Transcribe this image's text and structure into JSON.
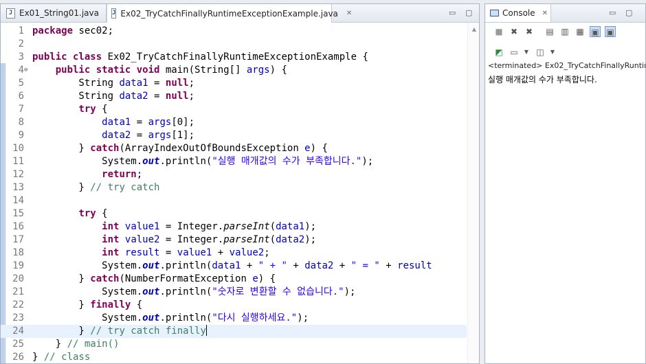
{
  "editor": {
    "tabs": [
      {
        "label": "Ex01_String01.java",
        "active": false
      },
      {
        "label": "Ex02_TryCatchFinallyRuntimeExceptionExample.java",
        "active": true
      }
    ],
    "close_glyph": "✕",
    "minimize_glyph": "▭",
    "maximize_glyph": "▢",
    "current_line": 24,
    "lines": [
      {
        "n": "1",
        "t": [
          [
            "k",
            "package"
          ],
          [
            "p",
            " sec02;"
          ]
        ]
      },
      {
        "n": "2",
        "t": []
      },
      {
        "n": "3",
        "t": [
          [
            "k",
            "public class"
          ],
          [
            "p",
            " Ex02_TryCatchFinallyRuntimeExceptionExample {"
          ]
        ]
      },
      {
        "n": "4",
        "fold": "⊖",
        "t": [
          [
            "p",
            "    "
          ],
          [
            "k",
            "public static void"
          ],
          [
            "p",
            " main(String[] "
          ],
          [
            "f",
            "args"
          ],
          [
            "p",
            ") {"
          ]
        ]
      },
      {
        "n": "5",
        "t": [
          [
            "p",
            "        String "
          ],
          [
            "f",
            "data1"
          ],
          [
            "p",
            " = "
          ],
          [
            "k",
            "null"
          ],
          [
            "p",
            ";"
          ]
        ]
      },
      {
        "n": "6",
        "t": [
          [
            "p",
            "        String "
          ],
          [
            "f",
            "data2"
          ],
          [
            "p",
            " = "
          ],
          [
            "k",
            "null"
          ],
          [
            "p",
            ";"
          ]
        ]
      },
      {
        "n": "7",
        "t": [
          [
            "p",
            "        "
          ],
          [
            "k",
            "try"
          ],
          [
            "p",
            " {"
          ]
        ]
      },
      {
        "n": "8",
        "t": [
          [
            "p",
            "            "
          ],
          [
            "f",
            "data1"
          ],
          [
            "p",
            " = "
          ],
          [
            "f",
            "args"
          ],
          [
            "p",
            "[0];"
          ]
        ]
      },
      {
        "n": "9",
        "t": [
          [
            "p",
            "            "
          ],
          [
            "f",
            "data2"
          ],
          [
            "p",
            " = "
          ],
          [
            "f",
            "args"
          ],
          [
            "p",
            "[1];"
          ]
        ]
      },
      {
        "n": "10",
        "t": [
          [
            "p",
            "        } "
          ],
          [
            "k",
            "catch"
          ],
          [
            "p",
            "(ArrayIndexOutOfBoundsException "
          ],
          [
            "f",
            "e"
          ],
          [
            "p",
            ") {"
          ]
        ]
      },
      {
        "n": "11",
        "t": [
          [
            "p",
            "            System."
          ],
          [
            "sf",
            "out"
          ],
          [
            "p",
            ".println("
          ],
          [
            "s",
            "\"실행 매개값의 수가 부족합니다.\""
          ],
          [
            "p",
            ");"
          ]
        ]
      },
      {
        "n": "12",
        "t": [
          [
            "p",
            "            "
          ],
          [
            "k",
            "return"
          ],
          [
            "p",
            ";"
          ]
        ]
      },
      {
        "n": "13",
        "t": [
          [
            "p",
            "        } "
          ],
          [
            "c",
            "// try catch"
          ]
        ]
      },
      {
        "n": "14",
        "t": []
      },
      {
        "n": "15",
        "t": [
          [
            "p",
            "        "
          ],
          [
            "k",
            "try"
          ],
          [
            "p",
            " {"
          ]
        ]
      },
      {
        "n": "16",
        "t": [
          [
            "p",
            "            "
          ],
          [
            "k",
            "int"
          ],
          [
            "p",
            " "
          ],
          [
            "f",
            "value1"
          ],
          [
            "p",
            " = Integer."
          ],
          [
            "i",
            "parseInt"
          ],
          [
            "p",
            "("
          ],
          [
            "f",
            "data1"
          ],
          [
            "p",
            ");"
          ]
        ]
      },
      {
        "n": "17",
        "t": [
          [
            "p",
            "            "
          ],
          [
            "k",
            "int"
          ],
          [
            "p",
            " "
          ],
          [
            "f",
            "value2"
          ],
          [
            "p",
            " = Integer."
          ],
          [
            "i",
            "parseInt"
          ],
          [
            "p",
            "("
          ],
          [
            "f",
            "data2"
          ],
          [
            "p",
            ");"
          ]
        ]
      },
      {
        "n": "18",
        "t": [
          [
            "p",
            "            "
          ],
          [
            "k",
            "int"
          ],
          [
            "p",
            " "
          ],
          [
            "f",
            "result"
          ],
          [
            "p",
            " = "
          ],
          [
            "f",
            "value1"
          ],
          [
            "p",
            " + "
          ],
          [
            "f",
            "value2"
          ],
          [
            "p",
            ";"
          ]
        ]
      },
      {
        "n": "19",
        "t": [
          [
            "p",
            "            System."
          ],
          [
            "sf",
            "out"
          ],
          [
            "p",
            ".println("
          ],
          [
            "f",
            "data1"
          ],
          [
            "p",
            " + "
          ],
          [
            "s",
            "\" + \""
          ],
          [
            "p",
            " + "
          ],
          [
            "f",
            "data2"
          ],
          [
            "p",
            " + "
          ],
          [
            "s",
            "\" = \""
          ],
          [
            "p",
            " + "
          ],
          [
            "f",
            "result"
          ]
        ]
      },
      {
        "n": "20",
        "t": [
          [
            "p",
            "        } "
          ],
          [
            "k",
            "catch"
          ],
          [
            "p",
            "(NumberFormatException "
          ],
          [
            "f",
            "e"
          ],
          [
            "p",
            ") {"
          ]
        ]
      },
      {
        "n": "21",
        "t": [
          [
            "p",
            "            System."
          ],
          [
            "sf",
            "out"
          ],
          [
            "p",
            ".println("
          ],
          [
            "s",
            "\"숫자로 변환할 수 없습니다.\""
          ],
          [
            "p",
            ");"
          ]
        ]
      },
      {
        "n": "22",
        "t": [
          [
            "p",
            "        } "
          ],
          [
            "k",
            "finally"
          ],
          [
            "p",
            " {"
          ]
        ]
      },
      {
        "n": "23",
        "t": [
          [
            "p",
            "            System."
          ],
          [
            "sf",
            "out"
          ],
          [
            "p",
            ".println("
          ],
          [
            "s",
            "\"다시 실행하세요.\""
          ],
          [
            "p",
            ");"
          ]
        ]
      },
      {
        "n": "24",
        "t": [
          [
            "p",
            "        } "
          ],
          [
            "c",
            "// try catch finally"
          ]
        ]
      },
      {
        "n": "25",
        "t": [
          [
            "p",
            "    } "
          ],
          [
            "c",
            "// main()"
          ]
        ]
      },
      {
        "n": "26",
        "t": [
          [
            "p",
            "} "
          ],
          [
            "c",
            "// class"
          ]
        ]
      }
    ]
  },
  "console": {
    "tab_label": "Console",
    "close_glyph": "✕",
    "terminated_label": "<terminated> Ex02_TryCatchFinallyRuntin",
    "output": "실행 매개값의 수가 부족합니다."
  }
}
